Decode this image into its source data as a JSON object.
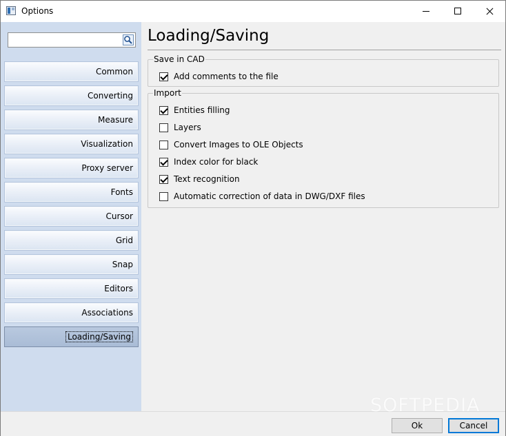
{
  "window": {
    "title": "Options"
  },
  "sidebar": {
    "search_value": "",
    "items": [
      {
        "label": "Common"
      },
      {
        "label": "Converting"
      },
      {
        "label": "Measure"
      },
      {
        "label": "Visualization"
      },
      {
        "label": "Proxy server"
      },
      {
        "label": "Fonts"
      },
      {
        "label": "Cursor"
      },
      {
        "label": "Grid"
      },
      {
        "label": "Snap"
      },
      {
        "label": "Editors"
      },
      {
        "label": "Associations"
      },
      {
        "label": "Loading/Saving",
        "active": true
      }
    ]
  },
  "main": {
    "title": "Loading/Saving",
    "save_group": {
      "legend": "Save in CAD",
      "options": [
        {
          "label": "Add comments to the file",
          "checked": true
        }
      ]
    },
    "import_group": {
      "legend": "Import",
      "options": [
        {
          "label": "Entities filling",
          "checked": true
        },
        {
          "label": "Layers",
          "checked": false
        },
        {
          "label": "Convert Images to OLE Objects",
          "checked": false
        },
        {
          "label": "Index color for black",
          "checked": true
        },
        {
          "label": "Text recognition",
          "checked": true
        },
        {
          "label": "Automatic correction of data in DWG/DXF files",
          "checked": false
        }
      ]
    }
  },
  "footer": {
    "ok_label": "Ok",
    "cancel_label": "Cancel"
  },
  "watermark": "SOFTPEDIA",
  "colors": {
    "sidebar_bg": "#cfdcee",
    "focus_border": "#0078d7"
  },
  "icons": [
    "options-app-icon",
    "search-icon",
    "minimize-icon",
    "maximize-icon",
    "close-icon"
  ]
}
